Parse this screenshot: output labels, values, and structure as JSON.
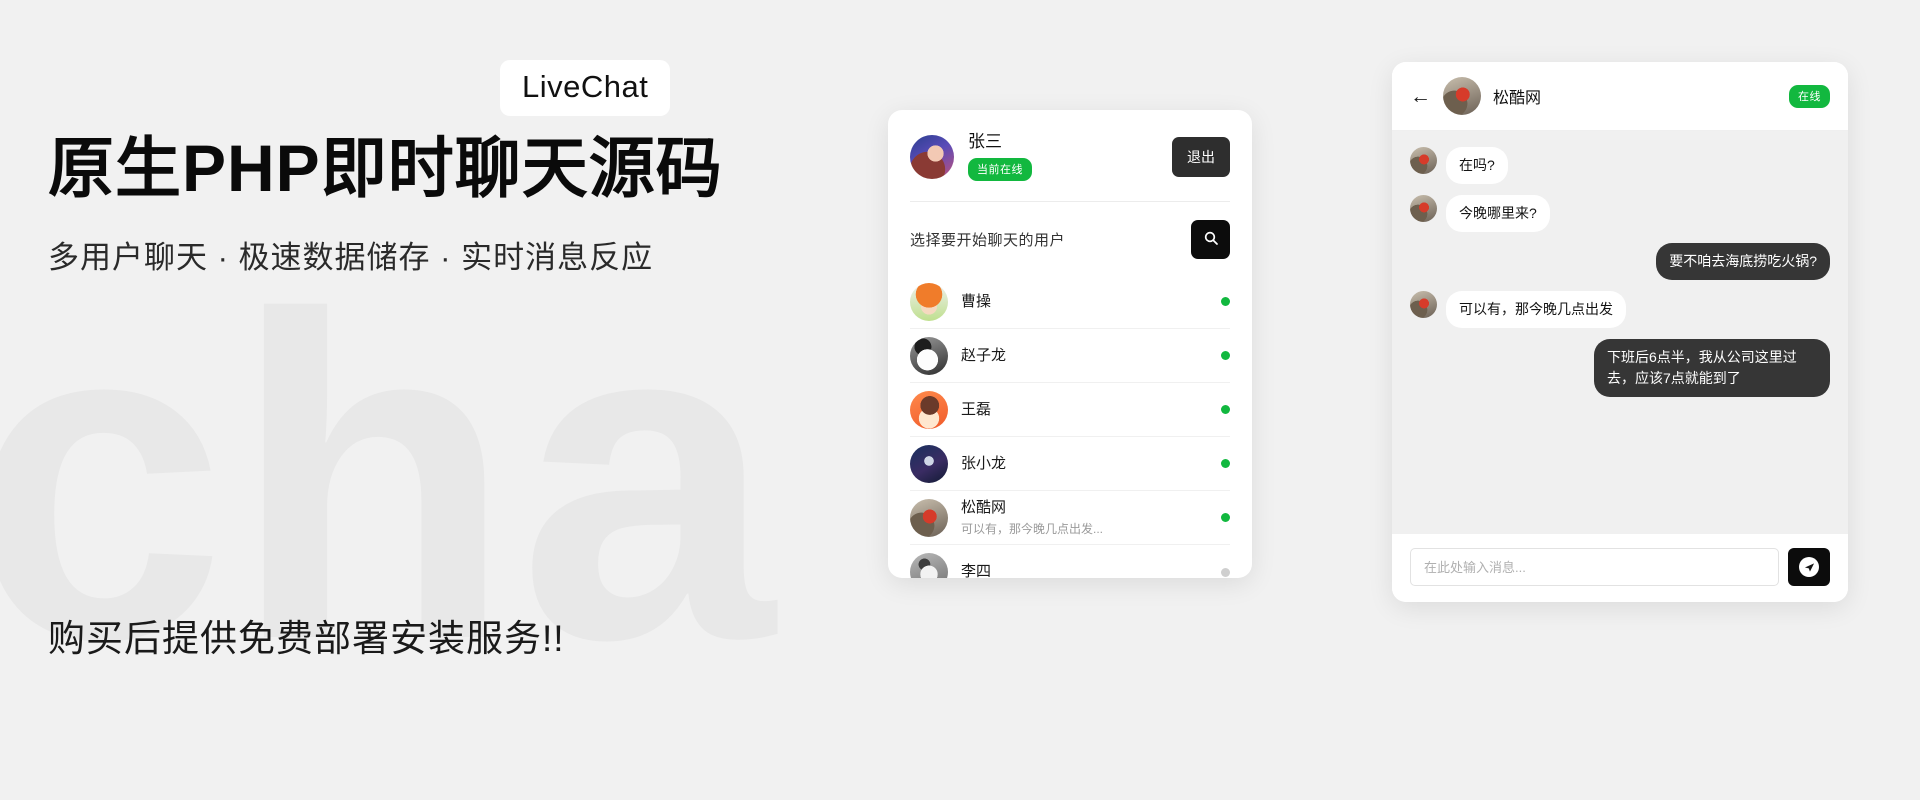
{
  "promo": {
    "badge": "LiveChat",
    "title": "原生PHP即时聊天源码",
    "subtitle": "多用户聊天 · 极速数据储存 · 实时消息反应",
    "footer": "购买后提供免费部署安装服务!!",
    "watermark": "cha",
    "accent_green": "#12b83f",
    "dark": "#0c0c0c"
  },
  "users_panel": {
    "current_user": {
      "name": "张三",
      "status_label": "当前在线",
      "avatar": "av-zhangsan"
    },
    "logout_label": "退出",
    "search_label": "选择要开始聊天的用户",
    "search_icon": "search-icon",
    "items": [
      {
        "name": "曹操",
        "preview": "",
        "online": true,
        "avatar": "av-caocao"
      },
      {
        "name": "赵子龙",
        "preview": "",
        "online": true,
        "avatar": "av-zhaozilong"
      },
      {
        "name": "王磊",
        "preview": "",
        "online": true,
        "avatar": "av-wanglei"
      },
      {
        "name": "张小龙",
        "preview": "",
        "online": true,
        "avatar": "av-zhangxiaolong"
      },
      {
        "name": "松酷网",
        "preview": "可以有，那今晚几点出发...",
        "online": true,
        "avatar": "av-songkuwang"
      },
      {
        "name": "李四",
        "preview": "",
        "online": false,
        "avatar": "av-lisi"
      }
    ]
  },
  "chat_panel": {
    "back_icon": "back-arrow-icon",
    "peer": {
      "name": "松酷网",
      "avatar": "av-songkuwang"
    },
    "status_label": "在线",
    "messages": [
      {
        "dir": "in",
        "text": "在吗?"
      },
      {
        "dir": "in",
        "text": "今晚哪里来?"
      },
      {
        "dir": "out",
        "text": "要不咱去海底捞吃火锅?"
      },
      {
        "dir": "in",
        "text": "可以有，那今晚几点出发"
      },
      {
        "dir": "out",
        "text": "下班后6点半，我从公司这里过去，应该7点就能到了"
      }
    ],
    "input_placeholder": "在此处输入消息...",
    "send_icon": "send-paper-plane-icon"
  }
}
